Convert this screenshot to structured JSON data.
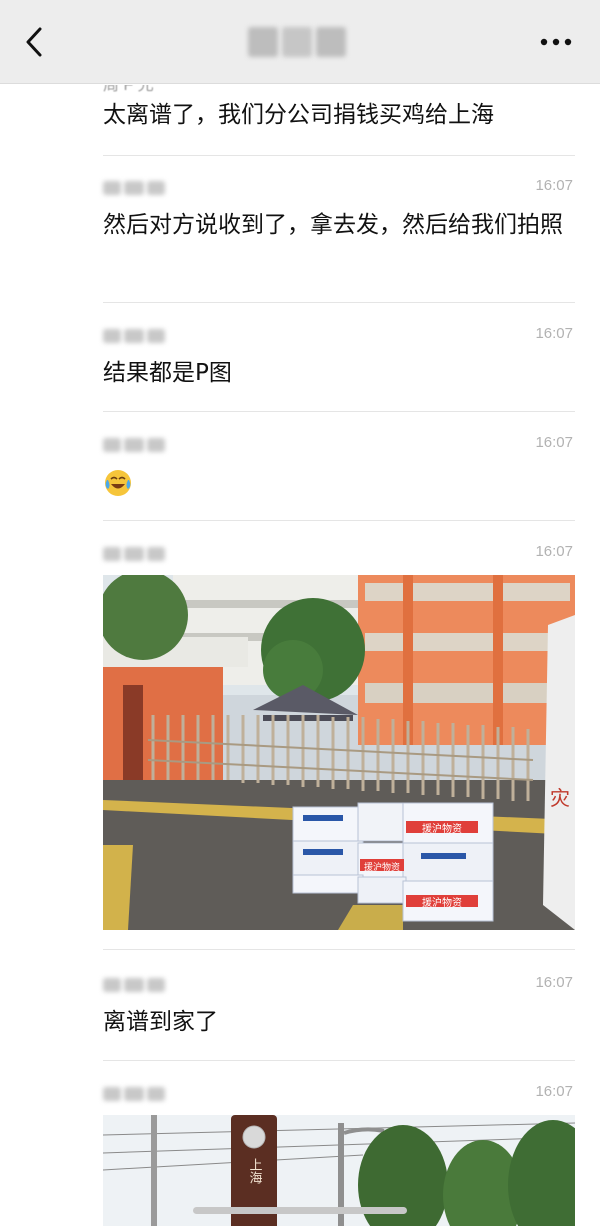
{
  "header": {
    "title_redacted": true,
    "back_icon": "chevron-left-icon",
    "more_icon": "more-icon"
  },
  "messages": [
    {
      "sender_partial": "周 F 允",
      "time": "",
      "text": "太离谱了，我们分公司捐钱买鸡给上海"
    },
    {
      "time": "16:07",
      "text": "然后对方说收到了，拿去发，然后给我们拍照"
    },
    {
      "time": "16:07",
      "text": "结果都是P图"
    },
    {
      "time": "16:07",
      "emoji": "crying-laughing-emoji"
    },
    {
      "time": "16:07",
      "image": {
        "box_label_1": "援沪物资",
        "box_label_2": "援沪物资",
        "box_label_3": "援沪物资",
        "side_sign": "灾"
      }
    },
    {
      "time": "16:07",
      "text": "离谱到家了"
    },
    {
      "time": "16:07",
      "image2": {
        "sign_text": "上海"
      }
    }
  ]
}
